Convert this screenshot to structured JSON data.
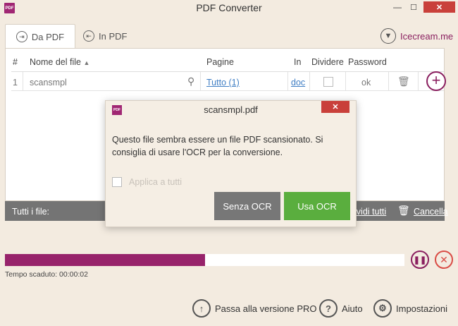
{
  "window": {
    "title": "PDF Converter",
    "logo_text": "PDF",
    "minimize": "—",
    "maximize": "☐",
    "close": "✕"
  },
  "tabs": [
    {
      "label": "Da PDF",
      "icon": "pdf-to-file-icon"
    },
    {
      "label": "In PDF",
      "icon": "file-to-pdf-icon"
    }
  ],
  "brand": {
    "label": "Icecream.me",
    "icon": "icecream-icon"
  },
  "table": {
    "headers": {
      "num": "#",
      "filename": "Nome del file",
      "pages": "Pagine",
      "in": "In",
      "split": "Dividere",
      "password": "Password"
    },
    "rows": [
      {
        "num": "1",
        "filename": "scansmpl",
        "pages": "Tutto (1)",
        "format": "doc",
        "password": "ok"
      }
    ]
  },
  "footer": {
    "all_files": "Tutti i file:",
    "split_all": "Dividi tutti",
    "cancel": "Cancella"
  },
  "progress": {
    "elapsed": "Tempo scaduto: 00:00:02",
    "value": 0.5
  },
  "bottom": {
    "upgrade": "Passa alla versione PRO",
    "help": "Aiuto",
    "settings": "Impostazioni"
  },
  "dialog": {
    "logo_text": "PDF",
    "title": "scansmpl.pdf",
    "close": "✕",
    "message": "Questo file sembra essere un file PDF scansionato. Si consiglia di usare l'OCR per la conversione.",
    "apply_all": "Applica a tutti",
    "no_ocr": "Senza OCR",
    "use_ocr": "Usa OCR"
  },
  "colors": {
    "accent": "#8a1f5f",
    "progress": "#97236b",
    "ocr_button": "#5aae3e",
    "close_red": "#c9403a",
    "link": "#3f7ec4"
  }
}
